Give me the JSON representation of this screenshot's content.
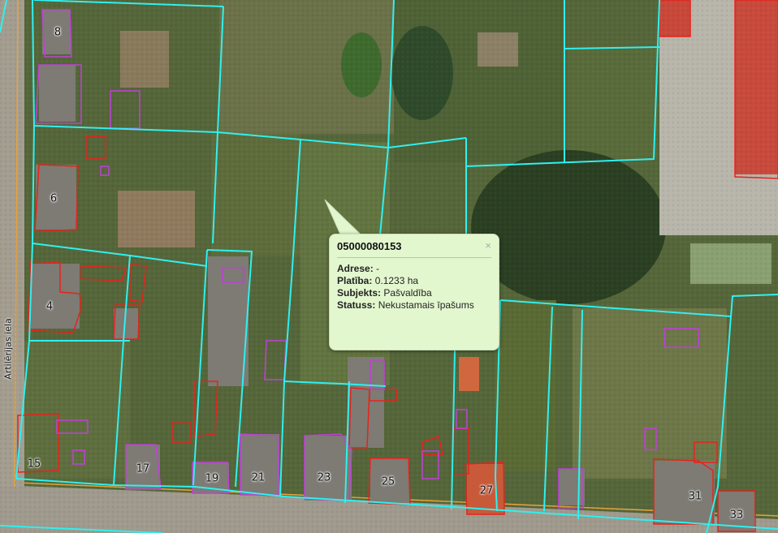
{
  "map": {
    "street_label": "Artilērijas iela",
    "parcel_numbers": [
      "8",
      "6",
      "4",
      "15",
      "17",
      "19",
      "21",
      "23",
      "25",
      "27",
      "31",
      "33"
    ]
  },
  "popup": {
    "title": "05000080153",
    "close_icon": "close-icon",
    "rows": [
      {
        "label": "Adrese:",
        "value": "-"
      },
      {
        "label": "Platība:",
        "value": "0.1233 ha"
      },
      {
        "label": "Subjekts:",
        "value": "Pašvaldība"
      },
      {
        "label": "Statuss:",
        "value": "Nekustamais īpašums"
      }
    ]
  },
  "colors": {
    "parcel_border": "#2ff0f0",
    "building_red": "#e8221c",
    "building_purple": "#c040d8",
    "popup_bg": "#e3f7cf"
  }
}
